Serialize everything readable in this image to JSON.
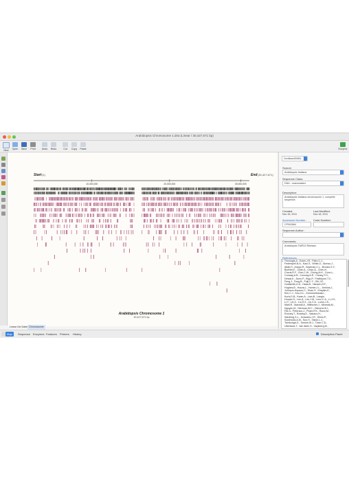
{
  "window": {
    "title": "Arabidopsis Chromosome 1.dna  (Linear / 30,427,671 bp)"
  },
  "toolbar": {
    "items": [
      {
        "label": "New",
        "icon": "new-file-icon"
      },
      {
        "label": "Open",
        "icon": "open-folder-icon"
      },
      {
        "label": "Save",
        "icon": "save-icon"
      },
      {
        "label": "Print",
        "icon": "print-icon"
      },
      {
        "label": "Undo",
        "icon": "undo-icon"
      },
      {
        "label": "Redo",
        "icon": "redo-icon"
      },
      {
        "label": "Cut",
        "icon": "cut-icon"
      },
      {
        "label": "Copy",
        "icon": "copy-icon"
      },
      {
        "label": "Paste",
        "icon": "paste-icon"
      }
    ],
    "right_label": "Enzyme"
  },
  "map": {
    "start_label": "Start",
    "start_value": "(1)",
    "end_label": "End",
    "end_value": "(30,427,671)",
    "ruler": [
      "10,000,000",
      "20,000,000",
      "30,000,000"
    ],
    "chrom_title": "Arabidopsis Chromosome 1",
    "chrom_length": "30,427,671 bp",
    "bar_color": "#a23a6e",
    "dark_color": "#333333"
  },
  "sidebar_right": {
    "header_select": "GenBank/EMBL",
    "source_label": "Source:",
    "source_value": "Arabidopsis thaliana",
    "seqclass_label": "Sequence Class:",
    "seqclass_value": "DNA - unannotated",
    "desc_label": "Description:",
    "desc_text": "Arabidopsis thaliana chromosome 1, complete sequence.",
    "created_label": "Created:",
    "created_value": "Nov 18, 2011",
    "modified_label": "Last Modified:",
    "modified_value": "Nov 18, 2011",
    "accession_label": "Accession Number:",
    "accession_value": "CP002684",
    "code_label": "Code Number:",
    "author_label": "Sequence Author:",
    "comments_label": "Comments:",
    "comments_text": "Arabidopsis TAIR10 Release.",
    "references_label": "References:",
    "references": [
      "1. Theologis,A., Ecker,J.R., Palm,C.J.,",
      "Federspiel,N.A., Kaul,S., White,O., Alonso,J.,",
      "Altafi,H., Araujo,R., Bowman,C.L., Brooks,S.Y.,",
      "Buehler,E., Chan,A., Chao,Q., Chen,H.,",
      "Cheuk,R.F., Chin,C.W., Chung,M.K., Conn,L.,",
      "Conway,A.B., Conway,A.R., Creasy,T.H.,",
      "Dewar,K., Dunn,P., Etgu,P., Feldblyum,T.V.,",
      "Feng,J., Fong,B., Fujii,C.Y., Gill,J.E.,",
      "Goldsmith,A.D., Haas,B., Hansen,N.F.,",
      "Hughes,B., Huizar,L., Hunter,J.L., Jenkins,J.,",
      "Johnson-Hopson,C., Khan,S., Khaykin,E.,",
      "Kim,C.J., Koo,H.L., Kremenetskaia,I.,",
      "Kurtz,D.B., Kwan,A., Lam,B., Langin,",
      "Hooper,S., Lee,A., Lee,J.M., Lenz,C.A., Li,J.H.,",
      "Li,Y., Lin,X., Liu,S.X., Liu,Z.A., Luros,J.S.,",
      "Maiti,R., Marziali,A., Militscher,J., Miranda,M.,",
      "Nguyen,M., Nierman,W.C., Osborne,B.I.,",
      "Pai,G., Peterson,J., Pham,P.K., Rizzo,M.,",
      "Rooney,T., Rowley,D., Sakano,H.,",
      "Salzberg,S.L., Schwartz,J.R., Shinn,P.,",
      "Southwick,A.M., Sun,H., Tallon,L.J.,",
      "Tambunga,G., Toriumi,M.J., Town,C.D.,",
      "Utterback,T., Van Aken,S., Vaysberg,M.,"
    ]
  },
  "bottom": {
    "sub_tabs": [
      "Linear Gel Gallery",
      "Chromosome"
    ],
    "tabs": [
      "Map",
      "Sequence",
      "Enzymes",
      "Features",
      "Primers",
      "History"
    ],
    "active_tab": "Map",
    "checkbox_label": "Description Panel"
  }
}
